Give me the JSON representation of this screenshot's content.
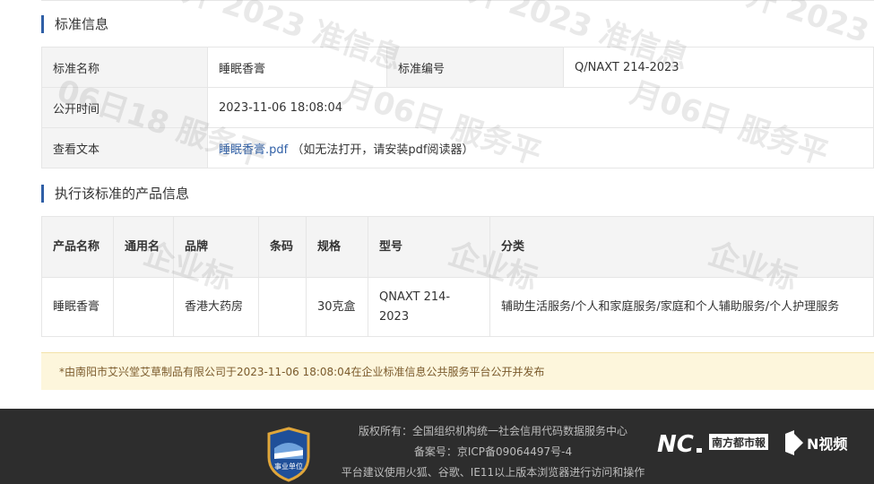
{
  "standard_section": {
    "title": "标准信息",
    "rows": [
      {
        "label1": "标准名称",
        "value1": "睡眠香膏",
        "label2": "标准编号",
        "value2": "Q/NAXT 214-2023"
      },
      {
        "label": "公开时间",
        "value": "2023-11-06 18:08:04"
      },
      {
        "label": "查看文本",
        "link": "睡眠香膏.pdf",
        "note": "（如无法打开，请安装pdf阅读器）"
      }
    ]
  },
  "product_section": {
    "title": "执行该标准的产品信息",
    "headers": [
      "产品名称",
      "通用名",
      "品牌",
      "条码",
      "规格",
      "型号",
      "分类"
    ],
    "rows": [
      [
        "睡眠香膏",
        "",
        "香港大药房",
        "",
        "30克盒",
        "QNAXT 214-2023",
        "辅助生活服务/个人和家庭服务/家庭和个人辅助服务/个人护理服务"
      ]
    ]
  },
  "notice": "*由南阳市艾兴堂艾草制品有限公司于2023-11-06 18:08:04在企业标准信息公共服务平台公开并发布",
  "footer": {
    "lines": [
      "版权所有：全国组织机构统一社会信用代码数据服务中心",
      "备案号：京ICP备09064497号-4",
      "平台建议使用火狐、谷歌、IE11以上版本浏览器进行访问和操作"
    ],
    "badge_text": "事业单位",
    "logo1_text": "南方都市報",
    "logo2_text": "N视频"
  },
  "colors": {
    "accent": "#2f5fa6",
    "notice_bg": "#fdf6dc",
    "footer_bg": "#2d2d2d"
  }
}
